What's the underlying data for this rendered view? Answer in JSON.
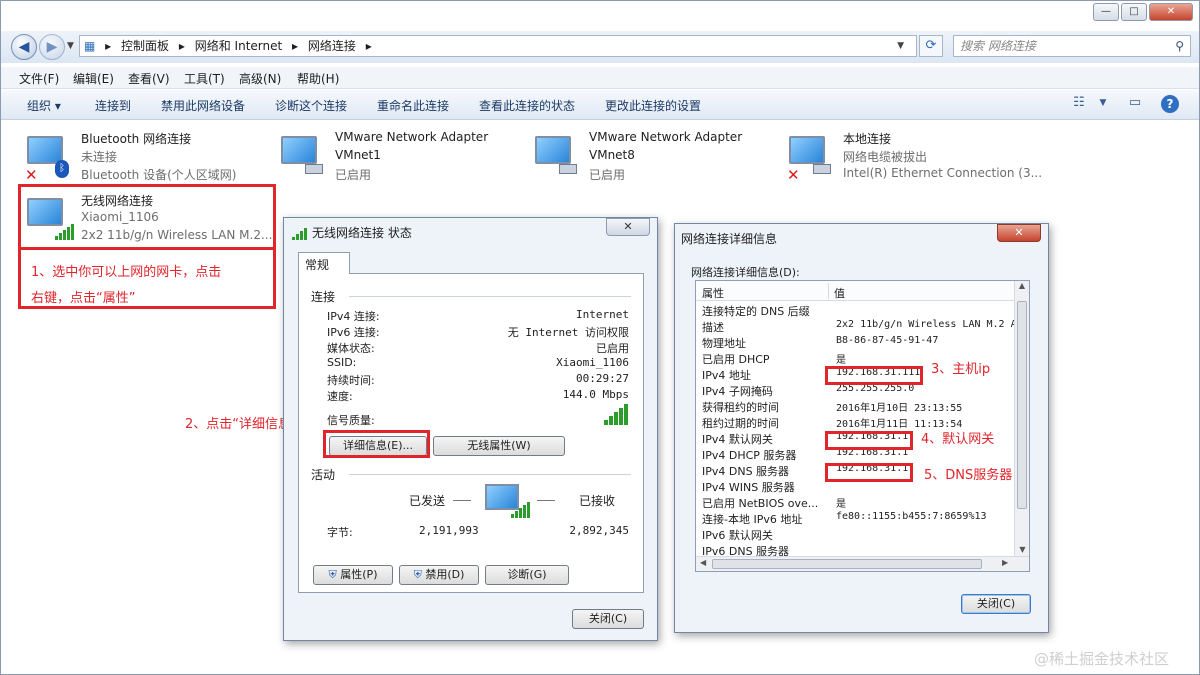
{
  "window": {
    "minimize": "—",
    "maximize": "□",
    "close": "✕"
  },
  "address": {
    "crumbs": [
      "控制面板",
      "网络和 Internet",
      "网络连接"
    ],
    "separator": "▸",
    "search_placeholder": "搜索 网络连接"
  },
  "menu": [
    "文件(F)",
    "编辑(E)",
    "查看(V)",
    "工具(T)",
    "高级(N)",
    "帮助(H)"
  ],
  "toolbar": [
    "组织 ▾",
    "连接到",
    "禁用此网络设备",
    "诊断这个连接",
    "重命名此连接",
    "查看此连接的状态",
    "更改此连接的设置"
  ],
  "connections": [
    {
      "name": "Bluetooth 网络连接",
      "status": "未连接",
      "device": "Bluetooth 设备(个人区域网)"
    },
    {
      "name": "VMware Network Adapter",
      "status": "VMnet1",
      "device": "已启用"
    },
    {
      "name": "VMware Network Adapter",
      "status": "VMnet8",
      "device": "已启用"
    },
    {
      "name": "本地连接",
      "status": "网络电缆被拔出",
      "device": "Intel(R) Ethernet Connection (3..."
    },
    {
      "name": "无线网络连接",
      "status": "Xiaomi_1106",
      "device": "2x2 11b/g/n Wireless LAN M.2..."
    }
  ],
  "notes": {
    "n1_line1": "1、选中你可以上网的网卡，点击",
    "n1_line2": "右键，点击“属性”",
    "n2": "2、点击“详细信息”",
    "n3": "3、主机ip",
    "n4": "4、默认网关",
    "n5": "5、DNS服务器"
  },
  "status_dialog": {
    "title": "无线网络连接 状态",
    "tab": "常规",
    "section_connection": "连接",
    "rows": [
      {
        "label": "IPv4 连接:",
        "value": "Internet"
      },
      {
        "label": "IPv6 连接:",
        "value": "无 Internet 访问权限"
      },
      {
        "label": "媒体状态:",
        "value": "已启用"
      },
      {
        "label": "SSID:",
        "value": "Xiaomi_1106"
      },
      {
        "label": "持续时间:",
        "value": "00:29:27"
      },
      {
        "label": "速度:",
        "value": "144.0 Mbps"
      }
    ],
    "signal_label": "信号质量:",
    "details_button": "详细信息(E)...",
    "wireless_props_button": "无线属性(W)",
    "section_activity": "活动",
    "sent_label": "已发送",
    "received_label": "已接收",
    "bytes_label": "字节:",
    "bytes_sent": "2,191,993",
    "bytes_received": "2,892,345",
    "properties_button": "属性(P)",
    "disable_button": "禁用(D)",
    "diagnose_button": "诊断(G)",
    "close_button": "关闭(C)"
  },
  "details_dialog": {
    "title": "网络连接详细信息",
    "caption": "网络连接详细信息(D):",
    "col_property": "属性",
    "col_value": "值",
    "rows": [
      {
        "p": "连接特定的 DNS 后缀",
        "v": ""
      },
      {
        "p": "描述",
        "v": "2x2 11b/g/n Wireless LAN M.2 A"
      },
      {
        "p": "物理地址",
        "v": "B8-86-87-45-91-47"
      },
      {
        "p": "已启用 DHCP",
        "v": "是"
      },
      {
        "p": "IPv4 地址",
        "v": "192.168.31.111"
      },
      {
        "p": "IPv4 子网掩码",
        "v": "255.255.255.0"
      },
      {
        "p": "获得租约的时间",
        "v": "2016年1月10日 23:13:55"
      },
      {
        "p": "租约过期的时间",
        "v": "2016年1月11日 11:13:54"
      },
      {
        "p": "IPv4 默认网关",
        "v": "192.168.31.1"
      },
      {
        "p": "IPv4 DHCP 服务器",
        "v": "192.168.31.1"
      },
      {
        "p": "IPv4 DNS 服务器",
        "v": "192.168.31.1"
      },
      {
        "p": "IPv4 WINS 服务器",
        "v": ""
      },
      {
        "p": "已启用 NetBIOS ove...",
        "v": "是"
      },
      {
        "p": "连接-本地 IPv6 地址",
        "v": "fe80::1155:b455:7:8659%13"
      },
      {
        "p": "IPv6 默认网关",
        "v": ""
      },
      {
        "p": "IPv6 DNS 服务器",
        "v": ""
      }
    ],
    "close_button": "关闭(C)"
  },
  "watermark": "@稀土掘金技术社区"
}
